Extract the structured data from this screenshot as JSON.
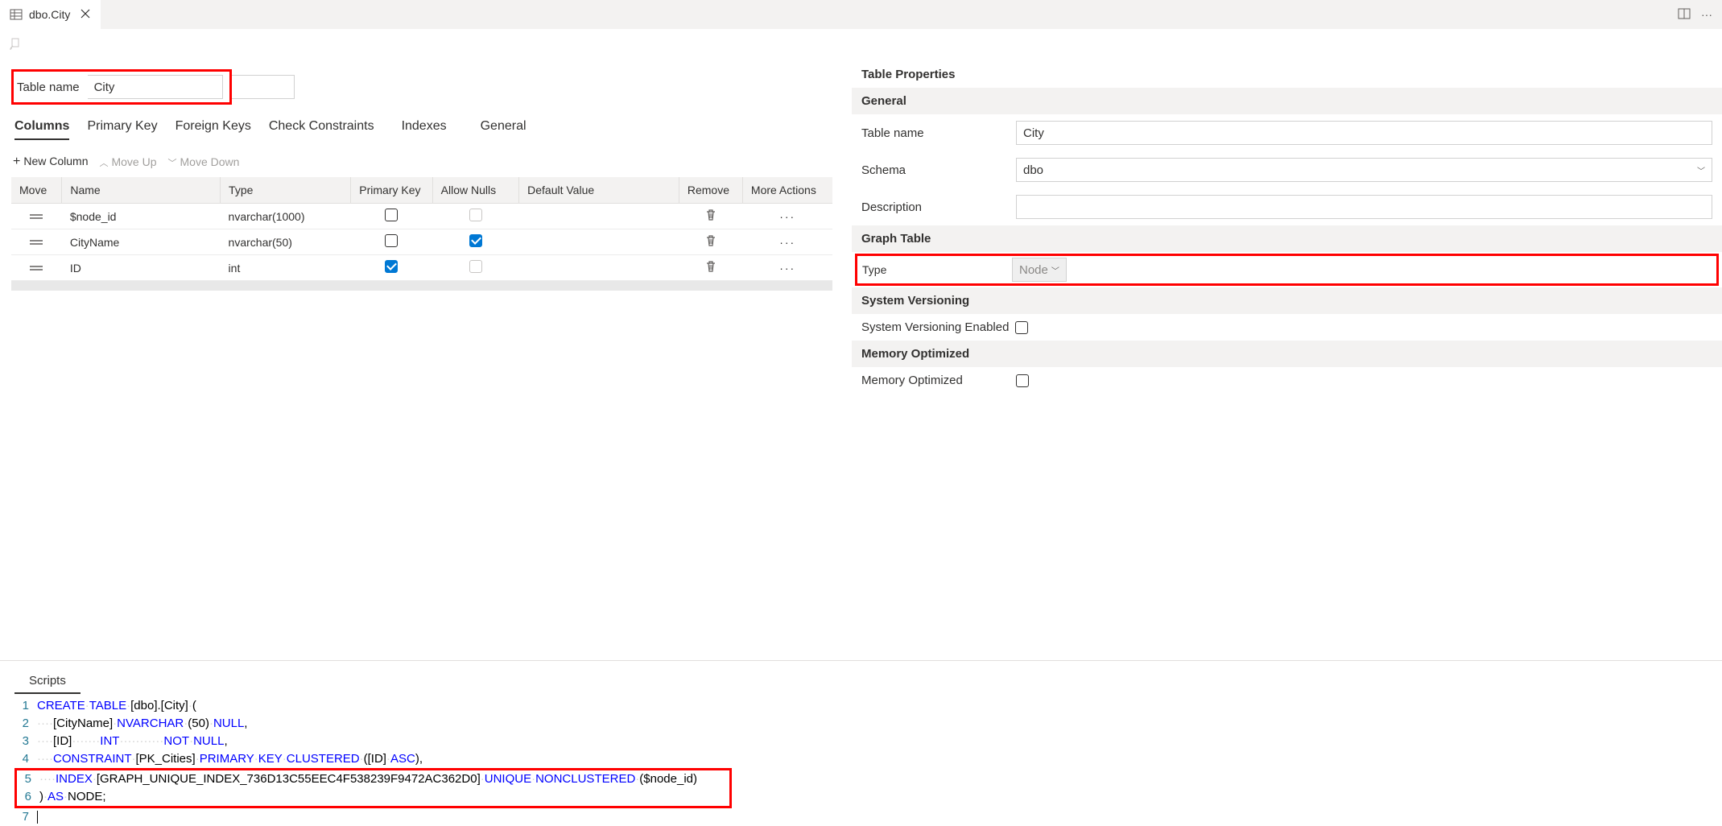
{
  "tab": {
    "title": "dbo.City"
  },
  "table_name_label": "Table name",
  "table_name_value": "City",
  "tabs2": [
    "Columns",
    "Primary Key",
    "Foreign Keys",
    "Check Constraints",
    "Indexes",
    "General"
  ],
  "row_actions": {
    "new": "New Column",
    "up": "Move Up",
    "down": "Move Down"
  },
  "grid": {
    "headers": [
      "Move",
      "Name",
      "Type",
      "Primary Key",
      "Allow Nulls",
      "Default Value",
      "Remove",
      "More Actions"
    ],
    "rows": [
      {
        "name": "$node_id",
        "type": "nvarchar(1000)",
        "pk": false,
        "pk_disabled": false,
        "nulls": false,
        "nulls_disabled": true,
        "default": ""
      },
      {
        "name": "CityName",
        "type": "nvarchar(50)",
        "pk": false,
        "pk_disabled": false,
        "nulls": true,
        "nulls_disabled": false,
        "default": ""
      },
      {
        "name": "ID",
        "type": "int",
        "pk": true,
        "pk_disabled": false,
        "nulls": false,
        "nulls_disabled": true,
        "default": ""
      }
    ]
  },
  "props": {
    "title": "Table Properties",
    "general": "General",
    "table_name_label": "Table name",
    "table_name_value": "City",
    "schema_label": "Schema",
    "schema_value": "dbo",
    "description_label": "Description",
    "description_value": "",
    "graph_table": "Graph Table",
    "type_label": "Type",
    "type_value": "Node",
    "sysver": "System Versioning",
    "sysver_enabled_label": "System Versioning Enabled",
    "memopt": "Memory Optimized",
    "memopt_label": "Memory Optimized"
  },
  "scripts": {
    "tab": "Scripts",
    "lines": [
      {
        "n": "1",
        "segs": [
          {
            "c": "kw-blue",
            "t": "CREATE"
          },
          {
            "c": "dots-grey",
            "t": "·"
          },
          {
            "c": "kw-blue",
            "t": "TABLE"
          },
          {
            "c": "dots-grey",
            "t": "·"
          },
          {
            "c": "kw-black",
            "t": "[dbo].[City]"
          },
          {
            "c": "dots-grey",
            "t": "·"
          },
          {
            "c": "kw-black",
            "t": "("
          }
        ]
      },
      {
        "n": "2",
        "segs": [
          {
            "c": "dots-grey",
            "t": "····"
          },
          {
            "c": "kw-black",
            "t": "[CityName]"
          },
          {
            "c": "dots-grey",
            "t": "·"
          },
          {
            "c": "kw-blue",
            "t": "NVARCHAR"
          },
          {
            "c": "dots-grey",
            "t": "·"
          },
          {
            "c": "kw-black",
            "t": "("
          },
          {
            "c": "kw-black",
            "t": "50"
          },
          {
            "c": "kw-black",
            "t": ")"
          },
          {
            "c": "dots-grey",
            "t": "·"
          },
          {
            "c": "kw-blue",
            "t": "NULL"
          },
          {
            "c": "kw-black",
            "t": ","
          }
        ]
      },
      {
        "n": "3",
        "segs": [
          {
            "c": "dots-grey",
            "t": "····"
          },
          {
            "c": "kw-black",
            "t": "[ID]"
          },
          {
            "c": "dots-grey",
            "t": "·······"
          },
          {
            "c": "kw-blue",
            "t": "INT"
          },
          {
            "c": "dots-grey",
            "t": "···········"
          },
          {
            "c": "kw-blue",
            "t": "NOT"
          },
          {
            "c": "dots-grey",
            "t": "·"
          },
          {
            "c": "kw-blue",
            "t": "NULL"
          },
          {
            "c": "kw-black",
            "t": ","
          }
        ]
      },
      {
        "n": "4",
        "segs": [
          {
            "c": "dots-grey",
            "t": "····"
          },
          {
            "c": "kw-blue",
            "t": "CONSTRAINT"
          },
          {
            "c": "dots-grey",
            "t": "·"
          },
          {
            "c": "kw-black",
            "t": "[PK_Cities]"
          },
          {
            "c": "dots-grey",
            "t": "·"
          },
          {
            "c": "kw-blue",
            "t": "PRIMARY"
          },
          {
            "c": "dots-grey",
            "t": "·"
          },
          {
            "c": "kw-blue",
            "t": "KEY"
          },
          {
            "c": "dots-grey",
            "t": "·"
          },
          {
            "c": "kw-blue",
            "t": "CLUSTERED"
          },
          {
            "c": "dots-grey",
            "t": "·"
          },
          {
            "c": "kw-black",
            "t": "([ID]"
          },
          {
            "c": "dots-grey",
            "t": "·"
          },
          {
            "c": "kw-blue",
            "t": "ASC"
          },
          {
            "c": "kw-black",
            "t": "),"
          }
        ]
      },
      {
        "n": "5",
        "hl": true,
        "segs": [
          {
            "c": "dots-grey",
            "t": "····"
          },
          {
            "c": "kw-blue",
            "t": "INDEX"
          },
          {
            "c": "dots-grey",
            "t": "·"
          },
          {
            "c": "kw-black",
            "t": "[GRAPH_UNIQUE_INDEX_736D13C55EEC4F538239F9472AC362D0]"
          },
          {
            "c": "dots-grey",
            "t": "·"
          },
          {
            "c": "kw-blue",
            "t": "UNIQUE"
          },
          {
            "c": "dots-grey",
            "t": "·"
          },
          {
            "c": "kw-blue",
            "t": "NONCLUSTERED"
          },
          {
            "c": "dots-grey",
            "t": "·"
          },
          {
            "c": "kw-black",
            "t": "($node_id)"
          }
        ]
      },
      {
        "n": "6",
        "hl": true,
        "segs": [
          {
            "c": "kw-black",
            "t": ")"
          },
          {
            "c": "dots-grey",
            "t": "·"
          },
          {
            "c": "kw-blue",
            "t": "AS"
          },
          {
            "c": "dots-grey",
            "t": "·"
          },
          {
            "c": "kw-black",
            "t": "NODE;"
          }
        ]
      },
      {
        "n": "7",
        "segs": []
      }
    ]
  }
}
